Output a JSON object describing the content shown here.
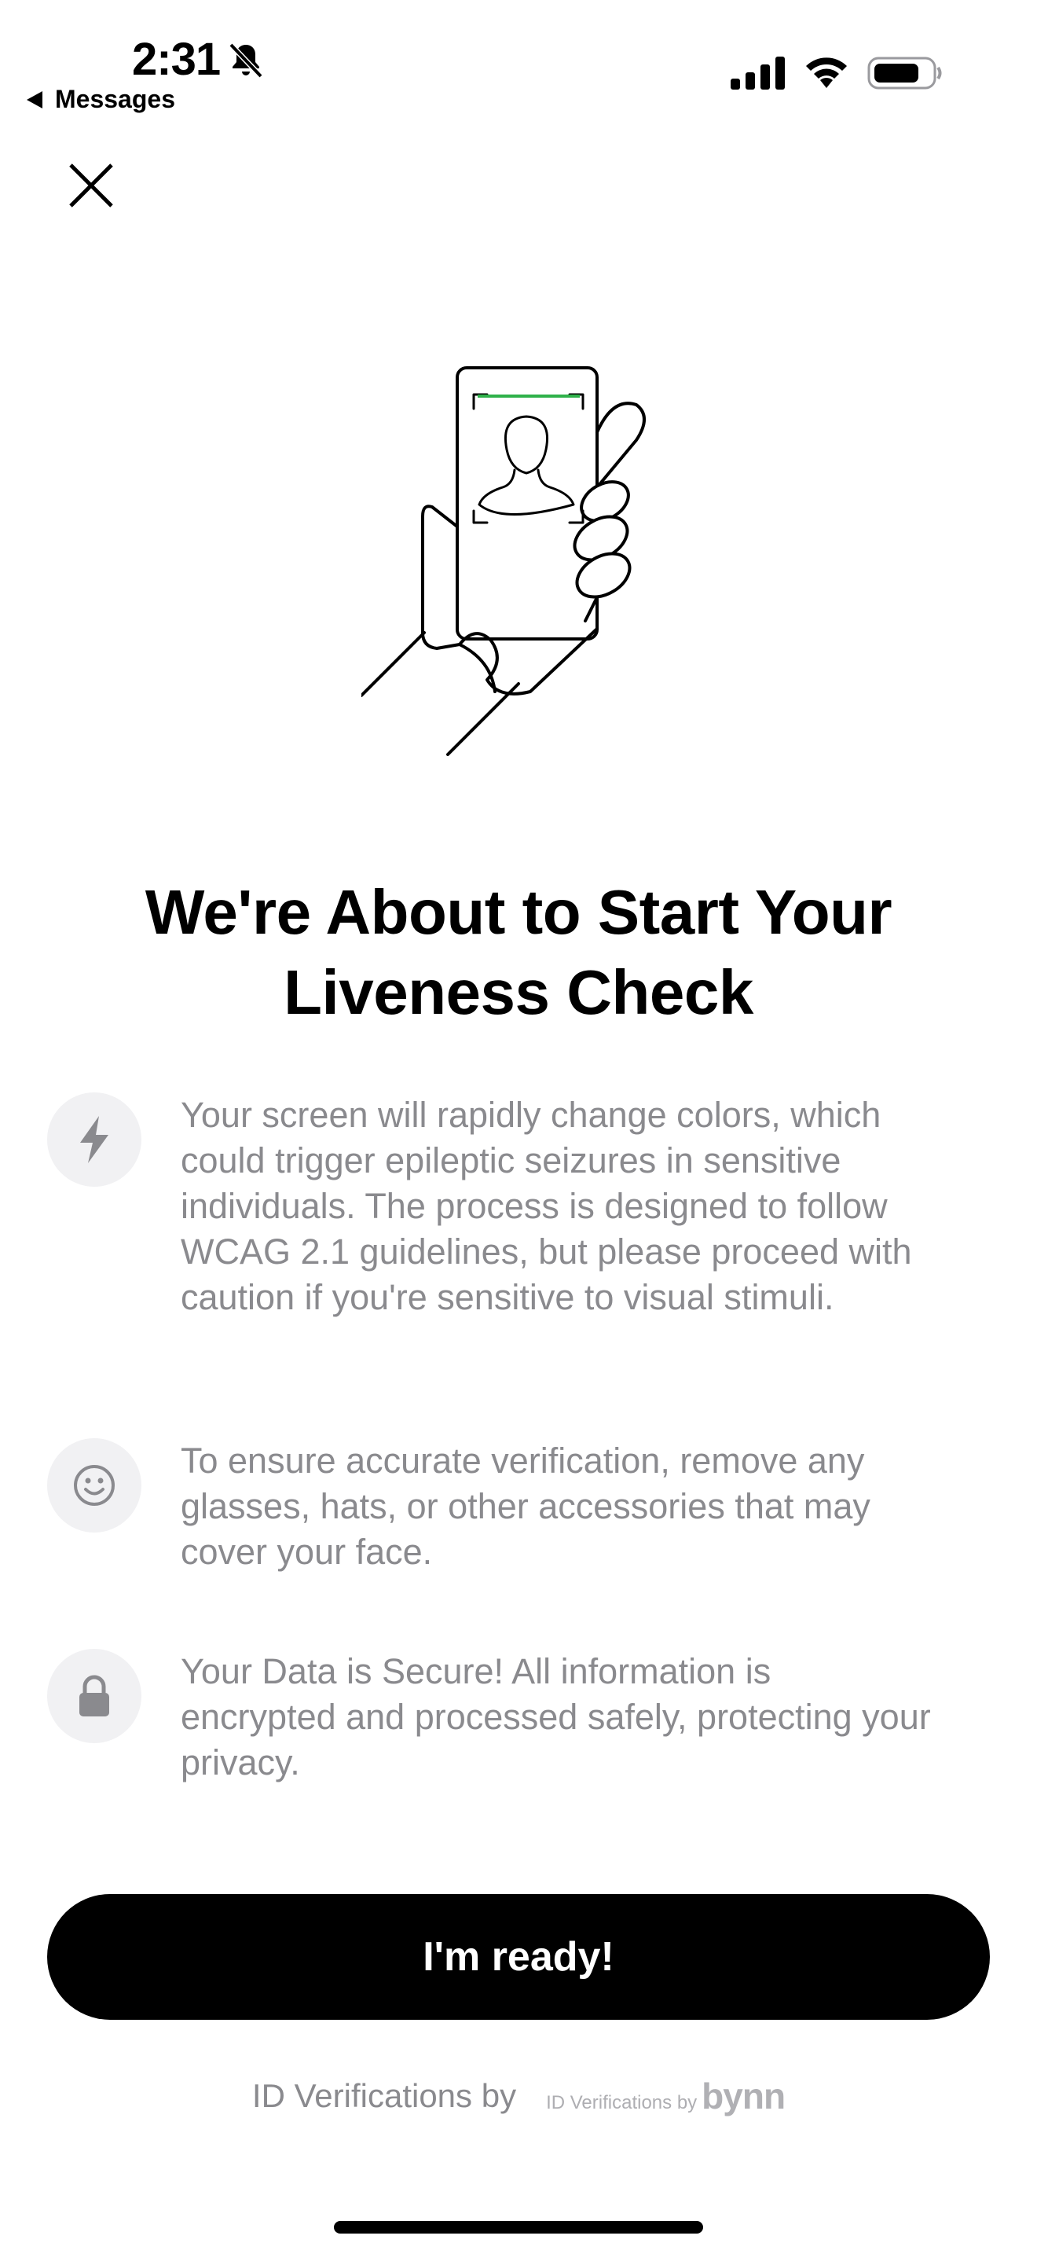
{
  "status_bar": {
    "time": "2:31",
    "back_label": "Messages"
  },
  "icons": {
    "close": "close-icon",
    "flash": "lightning-bolt-icon",
    "face": "smiley-face-icon",
    "lock": "lock-icon",
    "bell": "bell-slash-icon"
  },
  "title": "We're About to Start Your Liveness Check",
  "items": [
    {
      "text": "Your screen will rapidly change colors, which could trigger epileptic seizures in sensitive individuals. The process is designed to follow WCAG 2.1 guidelines, but please proceed with caution if you're sensitive to visual stimuli."
    },
    {
      "text": "To ensure accurate verification, remove any glasses, hats, or other accessories that may cover your face."
    },
    {
      "text": "Your Data is Secure! All information is encrypted and processed safely, protecting your privacy."
    }
  ],
  "ready_button": "I'm ready!",
  "footer": {
    "label": "ID Verifications by",
    "logo_small": "ID Verifications by",
    "logo_brand": "bynn"
  },
  "colors": {
    "accent_green": "#2fb14a",
    "text_muted": "#8a8a8e",
    "icon_bg": "#f1f1f3",
    "button_bg": "#000000"
  }
}
